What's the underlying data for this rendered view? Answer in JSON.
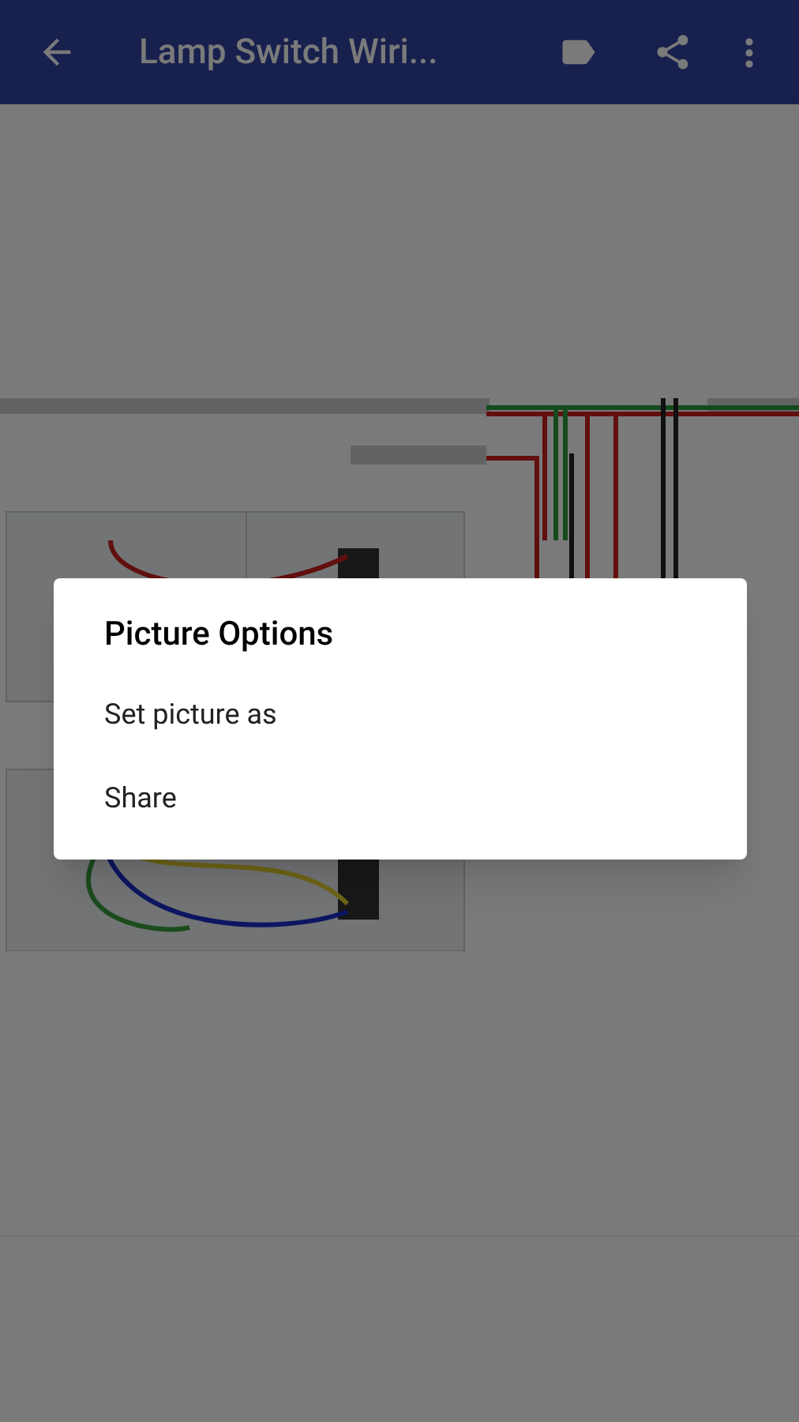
{
  "app_bar": {
    "title": "Lamp Switch Wiri..."
  },
  "dialog": {
    "title": "Picture Options",
    "options": [
      "Set picture as",
      "Share"
    ]
  }
}
